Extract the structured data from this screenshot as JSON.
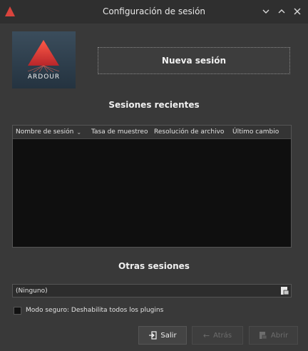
{
  "window": {
    "title": "Configuración de sesión",
    "controls": {
      "minimize": "⌄",
      "maximize": "⌃",
      "close": "×"
    }
  },
  "logo": {
    "text": "ARDOUR"
  },
  "new_session": {
    "label": "Nueva sesión"
  },
  "recent": {
    "title": "Sesiones recientes",
    "columns": [
      "Nombre de sesión",
      "Tasa de muestreo",
      "Resolución de archivo",
      "Último cambio"
    ],
    "sort_indicator": "⌄",
    "rows": []
  },
  "other": {
    "title": "Otras sesiones",
    "selected": "(Ninguno)"
  },
  "safe_mode": {
    "label": "Modo seguro: Deshabilita todos los plugins",
    "checked": false
  },
  "buttons": {
    "quit": "Salir",
    "back": "Atrás",
    "open": "Abrir"
  },
  "colors": {
    "accent_red": "#d9443d",
    "background": "#393939",
    "titlebar": "#2f2f2f"
  }
}
